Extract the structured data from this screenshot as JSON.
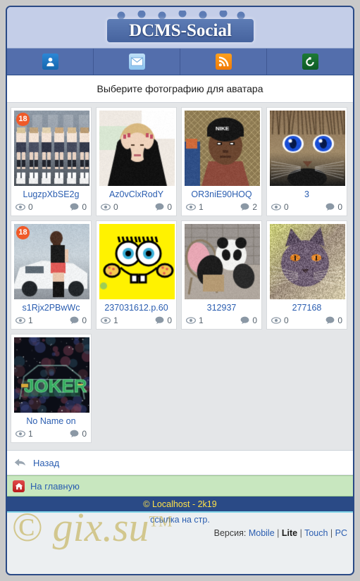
{
  "site": {
    "logo_text": "DCMS-Social"
  },
  "nav": [
    {
      "name": "profile",
      "icon": "user-icon"
    },
    {
      "name": "mail",
      "icon": "mail-icon"
    },
    {
      "name": "feed",
      "icon": "rss-icon"
    },
    {
      "name": "refresh",
      "icon": "refresh-icon"
    }
  ],
  "page": {
    "title": "Выберите фотографию для аватара"
  },
  "gallery": {
    "rows": [
      [
        {
          "title": "LugzpXbSE2g",
          "views": "0",
          "comments": "0",
          "adult": "18",
          "img": "girls-street"
        },
        {
          "title": "Az0vClxRodY",
          "views": "0",
          "comments": "0",
          "adult": "",
          "img": "blonde-girl"
        },
        {
          "title": "OR3niE90HOQ",
          "views": "1",
          "comments": "2",
          "adult": "",
          "img": "child-nike-cap"
        },
        {
          "title": "3",
          "views": "0",
          "comments": "0",
          "adult": "",
          "img": "blue-eyed-cat"
        }
      ],
      [
        {
          "title": "s1Rjx2PBwWc",
          "views": "1",
          "comments": "0",
          "adult": "18",
          "img": "girl-white-car"
        },
        {
          "title": "237031612.p.60",
          "views": "1",
          "comments": "0",
          "adult": "",
          "img": "spongebob-yellow"
        },
        {
          "title": "312937",
          "views": "1",
          "comments": "0",
          "adult": "",
          "img": "panda-chair"
        },
        {
          "title": "277168",
          "views": "0",
          "comments": "0",
          "adult": "",
          "img": "grainy-cat"
        }
      ],
      [
        {
          "title": "No Name on",
          "views": "1",
          "comments": "0",
          "adult": "",
          "img": "joker-car"
        }
      ]
    ]
  },
  "actions": {
    "back_label": "Назад",
    "home_label": "На главную"
  },
  "footer": {
    "copyright": "© Localhost - 2k19",
    "page_link": "ссылка на стр.",
    "version_label": "Версия:",
    "versions": [
      {
        "label": "Mobile",
        "current": false
      },
      {
        "label": "Lite",
        "current": true
      },
      {
        "label": "Touch",
        "current": false
      },
      {
        "label": "PC",
        "current": false
      }
    ],
    "watermark": "gix.su"
  },
  "colors": {
    "frame_border": "#2a4a86",
    "header_bg": "#c4cee8",
    "nav_bg": "#536eac",
    "link": "#2a5db0",
    "copy_bg": "#2a4a86",
    "copy_text": "#ffe24a",
    "home_bg": "#c8e7bf",
    "badge": "#f05a28"
  }
}
